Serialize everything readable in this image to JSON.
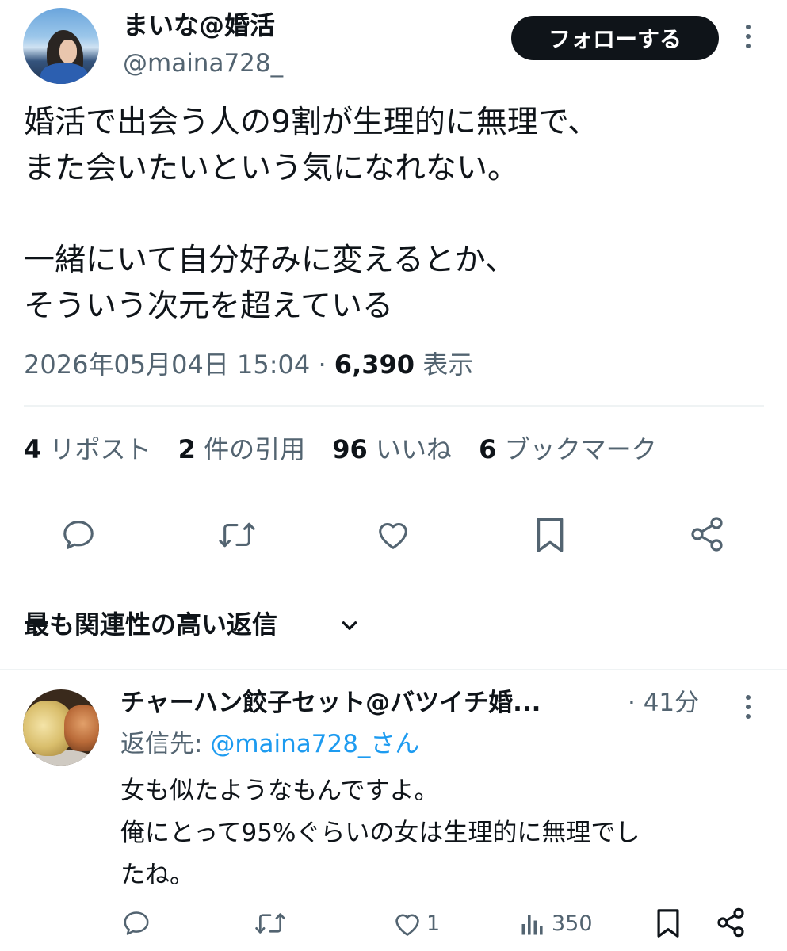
{
  "tweet": {
    "author": {
      "display_name": "まいな@婚活",
      "handle": "@maina728_"
    },
    "follow_label": "フォローする",
    "text": "婚活で出会う人の9割が生理的に無理で、\nまた会いたいという気になれない。\n\n一緒にいて自分好みに変えるとか、\nそういう次元を超えている",
    "datetime": "2026年05月04日 15:04",
    "separator": "·",
    "views": "6,390",
    "views_label": "表示",
    "stats": [
      {
        "count": "4",
        "label": "リポスト"
      },
      {
        "count": "2",
        "label": "件の引用"
      },
      {
        "count": "96",
        "label": "いいね"
      },
      {
        "count": "6",
        "label": "ブックマーク"
      }
    ],
    "actions": [
      "reply-icon",
      "retweet-icon",
      "like-icon",
      "bookmark-icon",
      "share-icon"
    ]
  },
  "sort": {
    "label": "最も関連性の高い返信"
  },
  "reply": {
    "author": {
      "display_name": "チャーハン餃子セット@バツイチ婚..."
    },
    "time": "· 41分",
    "reply_to_label": "返信先: ",
    "reply_to_handle": "@maina728_さん",
    "text": "女も似たようなもんですよ。\n俺にとって95%ぐらいの女は生理的に無理でし\nたね。",
    "actions": {
      "reply_count": "",
      "retweet_count": "",
      "like_count": "1",
      "views_count": "350"
    }
  },
  "colors": {
    "text_primary": "#0f1419",
    "text_secondary": "#536471",
    "link": "#1d9bf0",
    "divider": "#eff3f4",
    "follow_bg": "#0f1419"
  }
}
